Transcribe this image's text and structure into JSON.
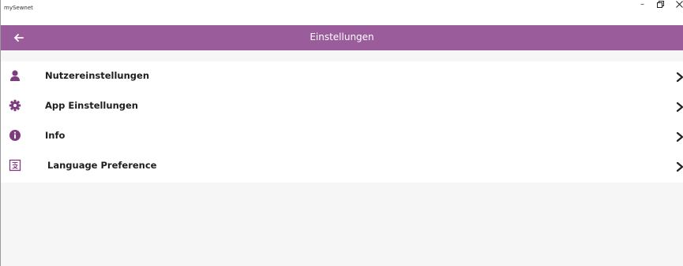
{
  "window": {
    "app_title": "mySewnet",
    "controls": {
      "minimize": "–",
      "maximize": "❐",
      "close": "✕"
    }
  },
  "header": {
    "title": "Einstellungen",
    "background_color": "#9b5c9c",
    "back_icon": "arrow-left-icon"
  },
  "menu": {
    "items": [
      {
        "label": "Nutzereinstellungen",
        "icon": "user-icon"
      },
      {
        "label": "App Einstellungen",
        "icon": "gear-icon"
      },
      {
        "label": "Info",
        "icon": "info-icon"
      },
      {
        "label": "Language Preference",
        "icon": "language-icon"
      }
    ],
    "icon_color": "#7e3b7f",
    "chevron_icon": "chevron-right-icon"
  }
}
